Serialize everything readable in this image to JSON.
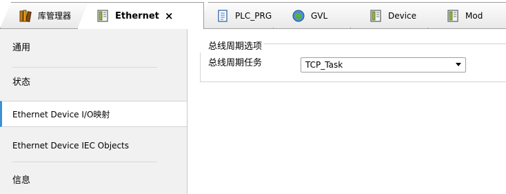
{
  "tabs": [
    {
      "label": "库管理器",
      "icon": "library-icon",
      "active": false
    },
    {
      "label": "Ethernet",
      "icon": "device-icon",
      "active": true,
      "close": "×"
    },
    {
      "label": "PLC_PRG",
      "icon": "document-icon",
      "active": false
    },
    {
      "label": "GVL",
      "icon": "globe-icon",
      "active": false
    },
    {
      "label": "Device",
      "icon": "device-icon",
      "active": false
    },
    {
      "label": "Mod",
      "icon": "device-icon",
      "active": false
    }
  ],
  "nav": {
    "items": [
      {
        "label": "通用"
      },
      {
        "label": "状态"
      },
      {
        "label": "Ethernet Device I/O映射",
        "selected": true
      },
      {
        "label": "Ethernet Device IEC Objects"
      },
      {
        "label": "信息"
      }
    ]
  },
  "content": {
    "group_title": "总线周期选项",
    "field_label": "总线周期任务",
    "select_value": "TCP_Task"
  },
  "colors": {
    "selection_accent": "#3b8fd6",
    "nav_background": "#f1f1f1"
  }
}
